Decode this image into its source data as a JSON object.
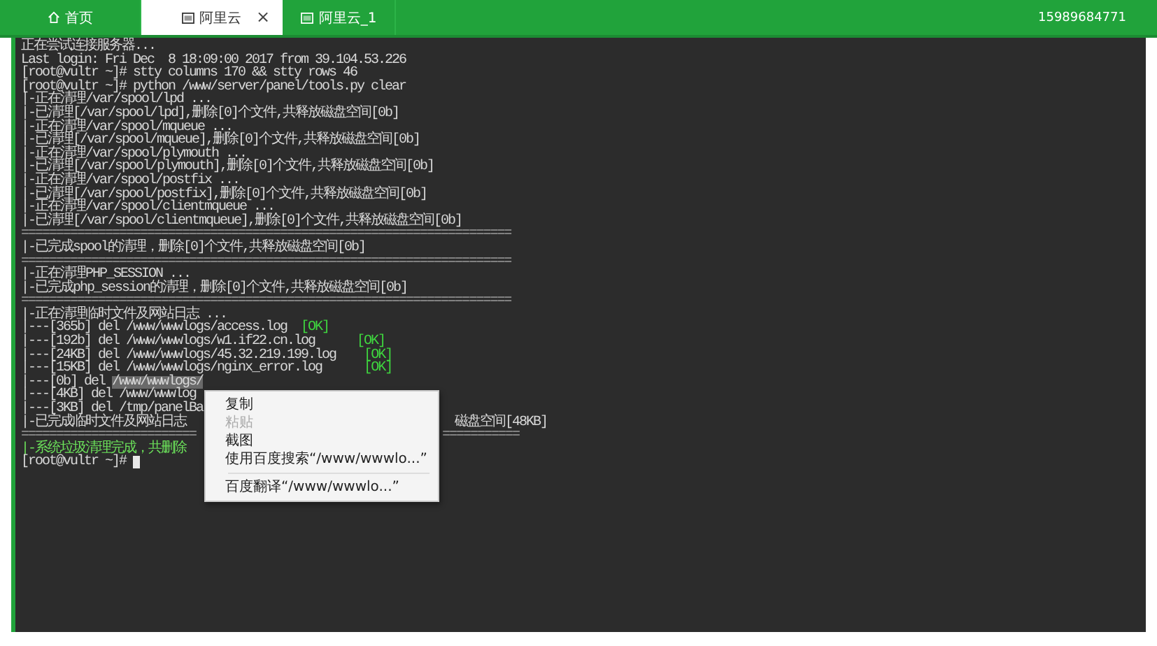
{
  "tabs": [
    {
      "label": "首页",
      "kind": "home",
      "selected": false
    },
    {
      "label": "阿里云",
      "kind": "server",
      "selected": true,
      "close": "×"
    },
    {
      "label": "阿里云_1",
      "kind": "server",
      "selected": false
    }
  ],
  "account": "15989684771",
  "terminal": {
    "lines": [
      [
        {
          "kind": "text",
          "text": "正在尝试连接服务器..."
        }
      ],
      [
        {
          "kind": "text",
          "text": "Last login: Fri Dec  8 18:09:00 2017 from 39.104.53.226"
        }
      ],
      [
        {
          "kind": "text",
          "text": "[root@vultr ~]# stty columns 170 && stty rows 46"
        }
      ],
      [
        {
          "kind": "text",
          "text": "[root@vultr ~]# python /www/server/panel/tools.py clear"
        }
      ],
      [
        {
          "kind": "text",
          "text": "|-正在清理/var/spool/lpd ..."
        }
      ],
      [
        {
          "kind": "text",
          "text": "|-已清理[/var/spool/lpd],删除[0]个文件,共释放磁盘空间[0b]"
        }
      ],
      [
        {
          "kind": "text",
          "text": "|-正在清理/var/spool/mqueue ..."
        }
      ],
      [
        {
          "kind": "text",
          "text": "|-已清理[/var/spool/mqueue],删除[0]个文件,共释放磁盘空间[0b]"
        }
      ],
      [
        {
          "kind": "text",
          "text": "|-正在清理/var/spool/plymouth ..."
        }
      ],
      [
        {
          "kind": "text",
          "text": "|-已清理[/var/spool/plymouth],删除[0]个文件,共释放磁盘空间[0b]"
        }
      ],
      [
        {
          "kind": "text",
          "text": "|-正在清理/var/spool/postfix ..."
        }
      ],
      [
        {
          "kind": "text",
          "text": "|-已清理[/var/spool/postfix],删除[0]个文件,共释放磁盘空间[0b]"
        }
      ],
      [
        {
          "kind": "text",
          "text": "|-正在清理/var/spool/clientmqueue ..."
        }
      ],
      [
        {
          "kind": "text",
          "text": "|-已清理[/var/spool/clientmqueue],删除[0]个文件,共释放磁盘空间[0b]"
        }
      ],
      [
        {
          "kind": "rule",
          "text": "======================================================================"
        }
      ],
      [
        {
          "kind": "text",
          "text": "|-已完成spool的清理，删除[0]个文件,共释放磁盘空间[0b]"
        }
      ],
      [
        {
          "kind": "rule",
          "text": "======================================================================"
        }
      ],
      [
        {
          "kind": "text",
          "text": "|-正在清理PHP_SESSION ..."
        }
      ],
      [
        {
          "kind": "text",
          "text": "|-已完成php_session的清理，删除[0]个文件,共释放磁盘空间[0b]"
        }
      ],
      [
        {
          "kind": "rule",
          "text": "======================================================================"
        }
      ],
      [
        {
          "kind": "text",
          "text": "|-正在清理临时文件及网站日志 ..."
        }
      ],
      [
        {
          "kind": "text",
          "text": "|---[365b] del /www/wwwlogs/access.log  "
        },
        {
          "kind": "ok",
          "text": "[OK]"
        }
      ],
      [
        {
          "kind": "text",
          "text": "|---[192b] del /www/wwwlogs/w1.if22.cn.log      "
        },
        {
          "kind": "ok",
          "text": "[OK]"
        }
      ],
      [
        {
          "kind": "text",
          "text": "|---[24KB] del /www/wwwlogs/45.32.219.199.log    "
        },
        {
          "kind": "ok",
          "text": "[OK]"
        }
      ],
      [
        {
          "kind": "text",
          "text": "|---[15KB] del /www/wwwlogs/nginx_error.log      "
        },
        {
          "kind": "ok",
          "text": "[OK]"
        }
      ],
      [
        {
          "kind": "text",
          "text": "|---[0b] del "
        },
        {
          "kind": "selected",
          "text": "/www/wwwlogs/"
        }
      ],
      [
        {
          "kind": "text",
          "text": "|---[4KB] del /www/wwwlog"
        }
      ],
      [
        {
          "kind": "text",
          "text": "|---[3KB] del /tmp/panelBa"
        }
      ],
      [
        {
          "kind": "text",
          "text": "|-已完成临时文件及网站日志"
        },
        {
          "kind": "after_menu",
          "text": "磁盘空间[48KB]"
        }
      ],
      [
        {
          "kind": "rule",
          "text": "========================="
        },
        {
          "kind": "rule_after_menu",
          "text": "==========="
        }
      ],
      [
        {
          "kind": "green",
          "text": "|-系统垃圾清理完成，共删除"
        }
      ],
      [
        {
          "kind": "text",
          "text": "[root@vultr ~]# "
        },
        {
          "kind": "cursor"
        }
      ]
    ]
  },
  "context_menu": [
    {
      "label": "复制",
      "kind": "item",
      "disabled": false
    },
    {
      "label": "粘贴",
      "kind": "item",
      "disabled": true
    },
    {
      "label": "截图",
      "kind": "item",
      "disabled": false
    },
    {
      "label": "使用百度搜索“/www/wwwlo...”",
      "kind": "item",
      "disabled": false
    },
    {
      "kind": "separator"
    },
    {
      "label": "百度翻译“/www/wwwlo...”",
      "kind": "item",
      "disabled": false
    }
  ]
}
